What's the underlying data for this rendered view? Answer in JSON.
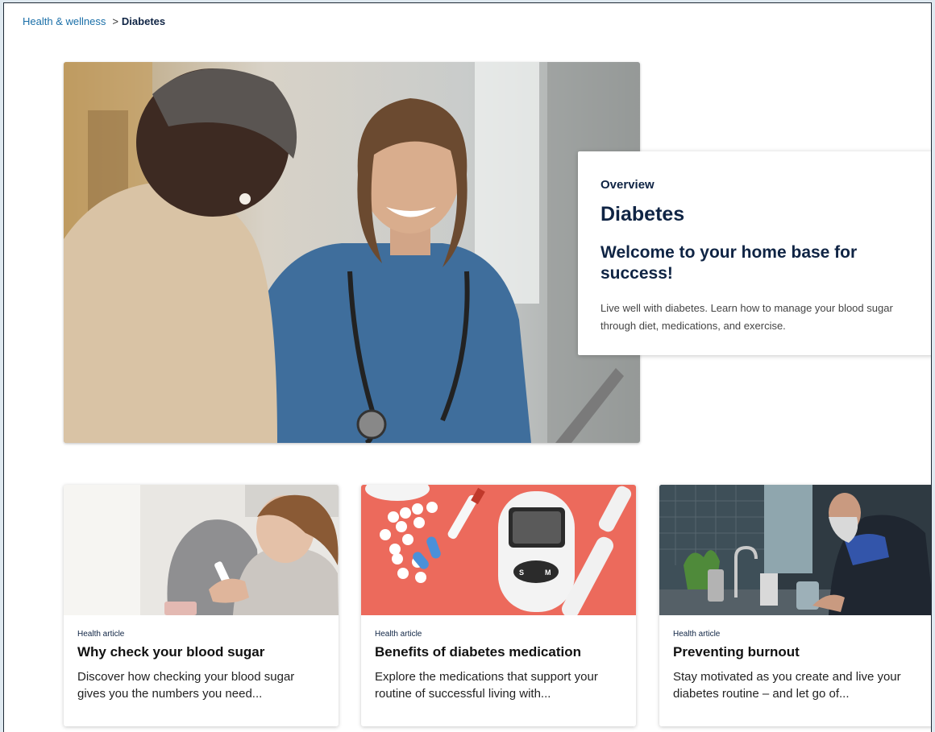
{
  "breadcrumb": {
    "parent": "Health & wellness",
    "separator": ">",
    "current": "Diabetes"
  },
  "hero": {
    "eyebrow": "Overview",
    "title": "Diabetes",
    "subtitle": "Welcome to your home base for success!",
    "description": "Live well with diabetes. Learn how to manage your blood sugar through diet, medications, and exercise."
  },
  "cards": [
    {
      "tag": "Health article",
      "title": "Why check your blood sugar",
      "description": "Discover how checking your blood sugar gives you the numbers you need..."
    },
    {
      "tag": "Health article",
      "title": "Benefits of diabetes medication",
      "description": "Explore the medications that support your routine of successful living with..."
    },
    {
      "tag": "Health article",
      "title": "Preventing burnout",
      "description": "Stay motivated as you create and live your diabetes routine – and let go of..."
    }
  ],
  "meter": {
    "buttons": [
      "S",
      "M"
    ]
  },
  "colors": {
    "link": "#1a6fa8",
    "navy": "#0f2444",
    "page_bg": "#dfe9f0"
  }
}
